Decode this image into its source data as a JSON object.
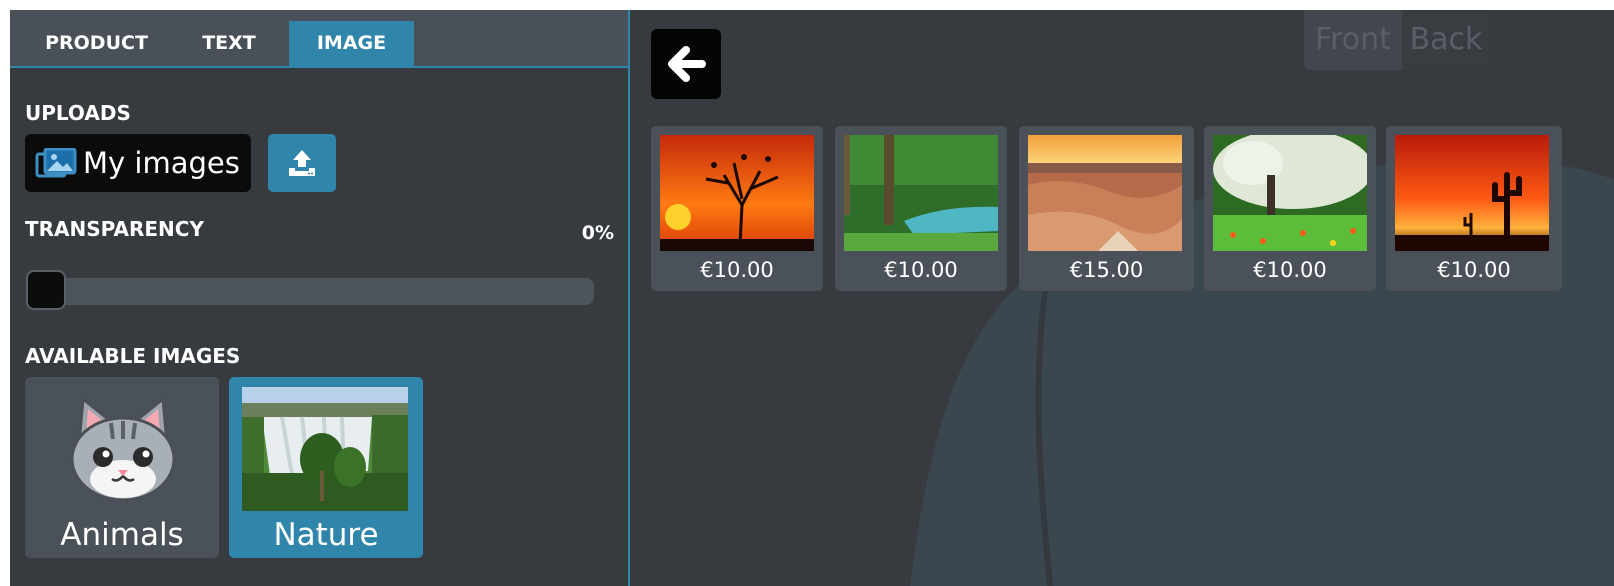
{
  "tabs": [
    {
      "label": "PRODUCT",
      "active": false
    },
    {
      "label": "TEXT",
      "active": false
    },
    {
      "label": "IMAGE",
      "active": true
    }
  ],
  "uploads": {
    "label": "UPLOADS",
    "my_images_label": "My images",
    "upload_icon": "upload-icon"
  },
  "transparency": {
    "label": "TRANSPARENCY",
    "value_text": "0%",
    "value": 0
  },
  "available_images": {
    "label": "AVAILABLE IMAGES",
    "categories": [
      {
        "label": "Animals",
        "icon": "cat-face-icon",
        "selected": false
      },
      {
        "label": "Nature",
        "icon": "waterfall-thumbnail",
        "selected": true
      }
    ]
  },
  "view": {
    "front_label": "Front",
    "back_label": "Back",
    "active": "back"
  },
  "gallery": {
    "items": [
      {
        "price": "€10.00",
        "image": "sunset-tree-birds"
      },
      {
        "price": "€10.00",
        "image": "forest-river"
      },
      {
        "price": "€15.00",
        "image": "canyon-sunrise"
      },
      {
        "price": "€10.00",
        "image": "blossom-tree-meadow"
      },
      {
        "price": "€10.00",
        "image": "desert-cactus-sunset"
      }
    ]
  },
  "colors": {
    "accent": "#2f86aa",
    "panel_bg": "#373b40",
    "tab_bar_bg": "#4a5058"
  }
}
